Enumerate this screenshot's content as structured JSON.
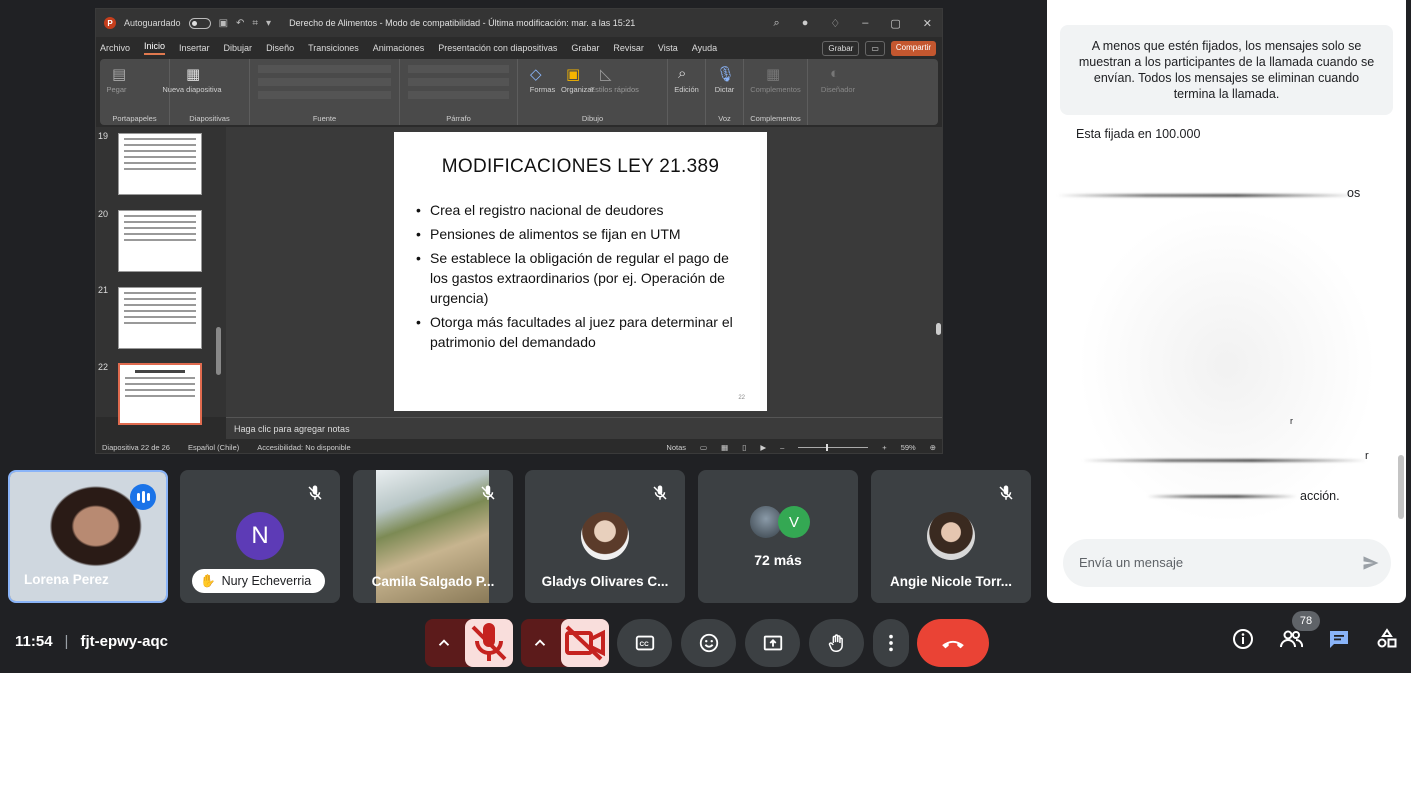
{
  "ppt": {
    "autosave_label": "Autoguardado",
    "doc_title": "Derecho de Alimentos  -  Modo de compatibilidad  -  Última modificación: mar. a las 15:21",
    "menu": [
      "Archivo",
      "Inicio",
      "Insertar",
      "Dibujar",
      "Diseño",
      "Transiciones",
      "Animaciones",
      "Presentación con diapositivas",
      "Grabar",
      "Revisar",
      "Vista",
      "Ayuda"
    ],
    "record_label": "Grabar",
    "share_label": "Compartir",
    "ribbon_groups": [
      "Portapapeles",
      "Diapositivas",
      "Fuente",
      "Párrafo",
      "Dibujo",
      "Voz",
      "Complementos"
    ],
    "ribbon_buttons": {
      "paste": "Pegar",
      "new_slide": "Nueva diapositiva",
      "shapes": "Formas",
      "arrange": "Organizar",
      "quick_styles": "Estilos rápidos",
      "editing": "Edición",
      "dictate": "Dictar",
      "addins": "Complementos",
      "designer": "Diseñador"
    },
    "thumbnails": [
      "19",
      "20",
      "21",
      "22"
    ],
    "slide": {
      "title": "MODIFICACIONES LEY 21.389",
      "bullets": [
        "Crea el registro nacional de deudores",
        "Pensiones de alimentos se fijan en UTM",
        "Se establece la obligación de regular el pago de los gastos extraordinarios (por ej. Operación de urgencia)",
        "Otorga más facultades al juez para determinar el patrimonio del demandado"
      ],
      "page_number": "22"
    },
    "notes_placeholder": "Haga clic para agregar notas",
    "status": {
      "slide_count": "Diapositiva 22 de 26",
      "language": "Español (Chile)",
      "accessibility": "Accesibilidad: No disponible",
      "notes": "Notas",
      "zoom": "59%"
    }
  },
  "chat": {
    "notice": "A menos que estén fijados, los mensajes solo se muestran a los participantes de la llamada cuando se envían. Todos los mensajes se eliminan cuando termina la llamada.",
    "message_1": "Esta fijada en 100.000",
    "fragment_1": "os",
    "fragment_2": "r",
    "fragment_3": "r",
    "fragment_4": "acción.",
    "input_placeholder": "Envía un mensaje"
  },
  "participants": [
    {
      "name": "Lorena Perez"
    },
    {
      "name": "Nury Echeverria",
      "initial": "N"
    },
    {
      "name": "Camila Salgado P..."
    },
    {
      "name": "Gladys Olivares C..."
    },
    {
      "more_label": "72 más",
      "initial": "V"
    },
    {
      "name": "Angie Nicole Torr..."
    }
  ],
  "meeting": {
    "time": "11:54",
    "code": "fjt-epwy-aqc",
    "participant_count": "78"
  },
  "colors": {
    "meet_bg": "#202124",
    "tile_bg": "#3c4043",
    "end_call": "#ea4335",
    "active_blue": "#1a73e8",
    "mic_off_bg": "#f9dedc",
    "ppt_accent": "#c43e1c"
  }
}
